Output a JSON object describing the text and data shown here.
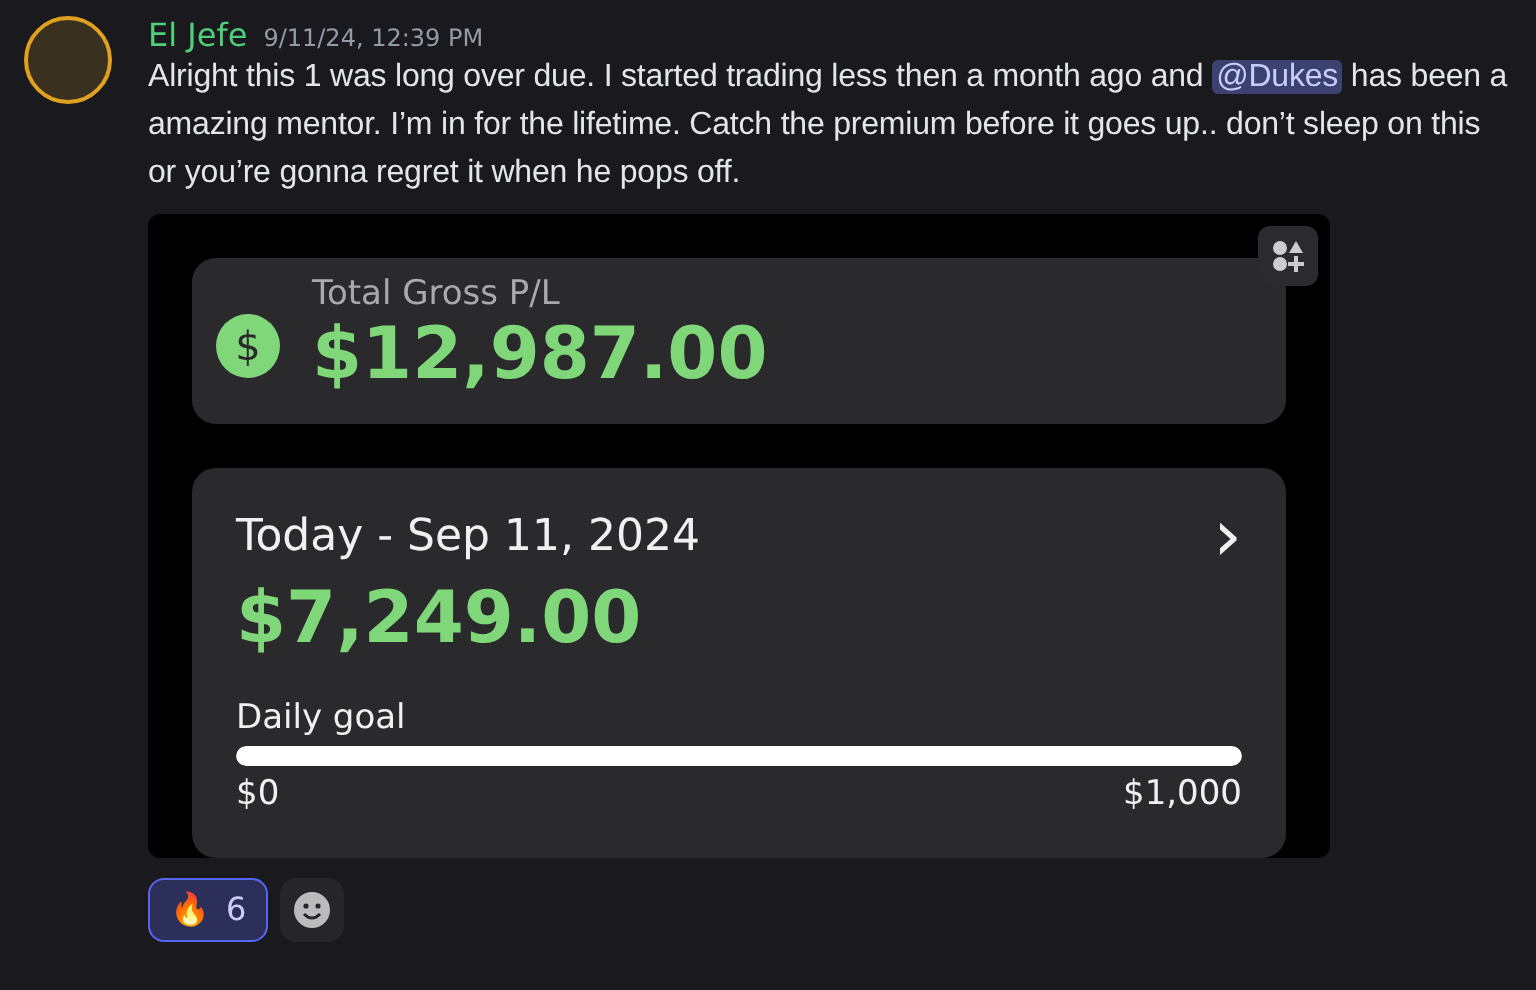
{
  "message": {
    "author": "El Jefe",
    "timestamp": "9/11/24, 12:39 PM",
    "lines": [
      {
        "before": "Alright this 1 was long over due. I started trading less then a month ago and ",
        "mention": "@Dukes",
        "after": " has been a"
      },
      {
        "before": "amazing mentor. I’m in for the lifetime. Catch the premium before it goes up.. don’t sleep on this"
      },
      {
        "before": "or you’re gonna regret it when he pops off."
      }
    ]
  },
  "embed": {
    "total": {
      "label": "Total Gross P/L",
      "icon": "$",
      "value": "$12,987.00"
    },
    "today": {
      "title": "Today - Sep 11, 2024",
      "chevron": "›",
      "value": "$7,249.00",
      "goal": {
        "label": "Daily goal",
        "level": 1,
        "min": "$0",
        "max": "$1,000"
      }
    }
  },
  "reactions": [
    {
      "emoji": "🔥",
      "count": "6",
      "selected": true
    }
  ]
}
